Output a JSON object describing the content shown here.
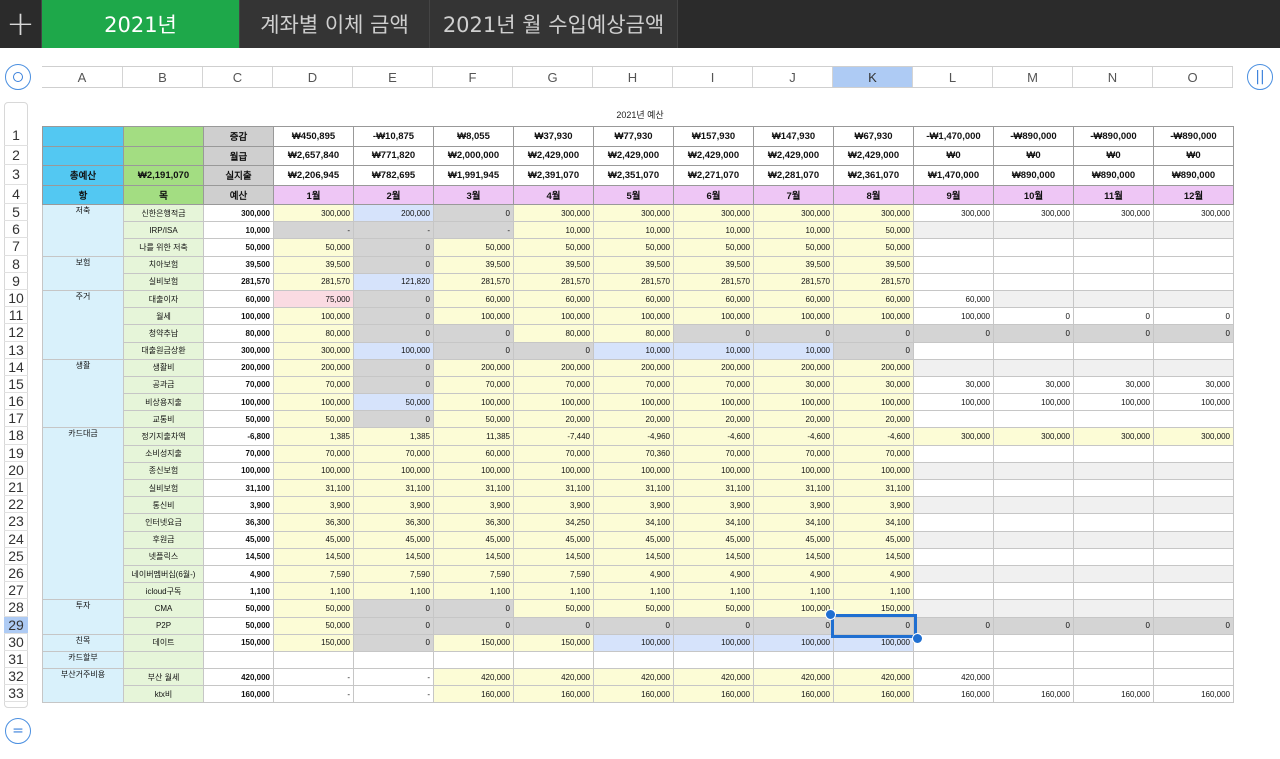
{
  "toolbar": {
    "add_label": "+"
  },
  "tabs": [
    "2021년",
    "계좌별 이체 금액",
    "2021년 월 수입예상금액"
  ],
  "left_circle": "",
  "right_circle": "||",
  "bottom_circle": "=",
  "columns": [
    "A",
    "B",
    "C",
    "D",
    "E",
    "F",
    "G",
    "H",
    "I",
    "J",
    "K",
    "L",
    "M",
    "N",
    "O"
  ],
  "selected_column": "K",
  "selected_row": 29,
  "sheet_title": "2021년 예산",
  "summary": {
    "left_a": [
      "",
      "",
      "총예산",
      "항"
    ],
    "left_b": [
      "",
      "",
      "₩2,191,070",
      "목"
    ],
    "left_c": [
      "증감",
      "월급",
      "실지출",
      "예산"
    ],
    "rows": [
      [
        "₩450,895",
        "-₩10,875",
        "₩8,055",
        "₩37,930",
        "₩77,930",
        "₩157,930",
        "₩147,930",
        "₩67,930",
        "-₩1,470,000",
        "-₩890,000",
        "-₩890,000",
        "-₩890,000"
      ],
      [
        "₩2,657,840",
        "₩771,820",
        "₩2,000,000",
        "₩2,429,000",
        "₩2,429,000",
        "₩2,429,000",
        "₩2,429,000",
        "₩2,429,000",
        "₩0",
        "₩0",
        "₩0",
        "₩0"
      ],
      [
        "₩2,206,945",
        "₩782,695",
        "₩1,991,945",
        "₩2,391,070",
        "₩2,351,070",
        "₩2,271,070",
        "₩2,281,070",
        "₩2,361,070",
        "₩1,470,000",
        "₩890,000",
        "₩890,000",
        "₩890,000"
      ]
    ],
    "months": [
      "1월",
      "2월",
      "3월",
      "4월",
      "5월",
      "6월",
      "7월",
      "8월",
      "9월",
      "10월",
      "11월",
      "12월"
    ]
  },
  "categories": [
    {
      "label": "저축",
      "rows": 3
    },
    {
      "label": "보험",
      "rows": 2
    },
    {
      "label": "주거",
      "rows": 4
    },
    {
      "label": "생활",
      "rows": 4
    },
    {
      "label": "카드대금",
      "rows": 10
    },
    {
      "label": "투자",
      "rows": 2
    },
    {
      "label": "친목",
      "rows": 1
    },
    {
      "label": "카드할부",
      "rows": 1
    },
    {
      "label": "부산거주비용",
      "rows": 2
    }
  ],
  "body": [
    {
      "n": 5,
      "item": "신한은행적금",
      "budget": "300,000",
      "v": [
        "300,000",
        "200,000",
        "0",
        "300,000",
        "300,000",
        "300,000",
        "300,000",
        "300,000",
        "300,000",
        "300,000",
        "300,000",
        "300,000"
      ],
      "c": "ybgyyyyywwww"
    },
    {
      "n": 6,
      "item": "IRP/ISA",
      "budget": "10,000",
      "v": [
        "-",
        "-",
        "-",
        "10,000",
        "10,000",
        "10,000",
        "10,000",
        "50,000",
        "",
        "",
        "",
        ""
      ],
      "c": "gggyyyyyllll"
    },
    {
      "n": 7,
      "item": "나를 위한 저축",
      "budget": "50,000",
      "v": [
        "50,000",
        "0",
        "50,000",
        "50,000",
        "50,000",
        "50,000",
        "50,000",
        "50,000",
        "",
        "",
        "",
        ""
      ],
      "c": "ygyyyyyywwww"
    },
    {
      "n": 8,
      "item": "치아보험",
      "budget": "39,500",
      "v": [
        "39,500",
        "0",
        "39,500",
        "39,500",
        "39,500",
        "39,500",
        "39,500",
        "39,500",
        "",
        "",
        "",
        ""
      ],
      "c": "ygyyyyyywwww"
    },
    {
      "n": 9,
      "item": "실비보험",
      "budget": "281,570",
      "v": [
        "281,570",
        "121,820",
        "281,570",
        "281,570",
        "281,570",
        "281,570",
        "281,570",
        "281,570",
        "",
        "",
        "",
        ""
      ],
      "c": "ybyyyyyywwww"
    },
    {
      "n": 10,
      "item": "대출이자",
      "budget": "60,000",
      "v": [
        "75,000",
        "0",
        "60,000",
        "60,000",
        "60,000",
        "60,000",
        "60,000",
        "60,000",
        "60,000",
        "",
        "",
        ""
      ],
      "c": "pgyyyyyywlll"
    },
    {
      "n": 11,
      "item": "월세",
      "budget": "100,000",
      "v": [
        "100,000",
        "0",
        "100,000",
        "100,000",
        "100,000",
        "100,000",
        "100,000",
        "100,000",
        "100,000",
        "0",
        "0",
        "0"
      ],
      "c": "ygyyyyyywwww"
    },
    {
      "n": 12,
      "item": "청약추납",
      "budget": "80,000",
      "v": [
        "80,000",
        "0",
        "0",
        "80,000",
        "80,000",
        "0",
        "0",
        "0",
        "0",
        "0",
        "0",
        "0"
      ],
      "c": "yggyyggggggg"
    },
    {
      "n": 13,
      "item": "대출원금상환",
      "budget": "300,000",
      "v": [
        "300,000",
        "100,000",
        "0",
        "0",
        "10,000",
        "10,000",
        "10,000",
        "0",
        "",
        "",
        "",
        ""
      ],
      "c": "ybggbbbgwwww"
    },
    {
      "n": 14,
      "item": "생활비",
      "budget": "200,000",
      "v": [
        "200,000",
        "0",
        "200,000",
        "200,000",
        "200,000",
        "200,000",
        "200,000",
        "200,000",
        "",
        "",
        "",
        ""
      ],
      "c": "ygyyyyyyllll"
    },
    {
      "n": 15,
      "item": "공과금",
      "budget": "70,000",
      "v": [
        "70,000",
        "0",
        "70,000",
        "70,000",
        "70,000",
        "70,000",
        "30,000",
        "30,000",
        "30,000",
        "30,000",
        "30,000",
        "30,000"
      ],
      "c": "ygyyyyyywwww"
    },
    {
      "n": 16,
      "item": "비상용지출",
      "budget": "100,000",
      "v": [
        "100,000",
        "50,000",
        "100,000",
        "100,000",
        "100,000",
        "100,000",
        "100,000",
        "100,000",
        "100,000",
        "100,000",
        "100,000",
        "100,000"
      ],
      "c": "ybyyyyyywwww"
    },
    {
      "n": 17,
      "item": "교통비",
      "budget": "50,000",
      "v": [
        "50,000",
        "0",
        "50,000",
        "20,000",
        "20,000",
        "20,000",
        "20,000",
        "20,000",
        "",
        "",
        "",
        ""
      ],
      "c": "ygyyyyyywwww"
    },
    {
      "n": 18,
      "item": "정기지출차액",
      "budget": "-6,800",
      "v": [
        "1,385",
        "1,385",
        "11,385",
        "-7,440",
        "-4,960",
        "-4,600",
        "-4,600",
        "-4,600",
        "300,000",
        "300,000",
        "300,000",
        "300,000"
      ],
      "c": "yyyyyyyyyyyy"
    },
    {
      "n": 19,
      "item": "소비성지출",
      "budget": "70,000",
      "v": [
        "70,000",
        "70,000",
        "60,000",
        "70,000",
        "70,360",
        "70,000",
        "70,000",
        "70,000",
        "",
        "",
        "",
        ""
      ],
      "c": "yyyyyyyywwww"
    },
    {
      "n": 20,
      "item": "종신보험",
      "budget": "100,000",
      "v": [
        "100,000",
        "100,000",
        "100,000",
        "100,000",
        "100,000",
        "100,000",
        "100,000",
        "100,000",
        "",
        "",
        "",
        ""
      ],
      "c": "yyyyyyyyllll"
    },
    {
      "n": 21,
      "item": "실비보험",
      "budget": "31,100",
      "v": [
        "31,100",
        "31,100",
        "31,100",
        "31,100",
        "31,100",
        "31,100",
        "31,100",
        "31,100",
        "",
        "",
        "",
        ""
      ],
      "c": "yyyyyyyywwww"
    },
    {
      "n": 22,
      "item": "통신비",
      "budget": "3,900",
      "v": [
        "3,900",
        "3,900",
        "3,900",
        "3,900",
        "3,900",
        "3,900",
        "3,900",
        "3,900",
        "",
        "",
        "",
        ""
      ],
      "c": "yyyyyyyyllll"
    },
    {
      "n": 23,
      "item": "인터넷요금",
      "budget": "36,300",
      "v": [
        "36,300",
        "36,300",
        "36,300",
        "34,250",
        "34,100",
        "34,100",
        "34,100",
        "34,100",
        "",
        "",
        "",
        ""
      ],
      "c": "yyyyyyyywwww"
    },
    {
      "n": 24,
      "item": "후원금",
      "budget": "45,000",
      "v": [
        "45,000",
        "45,000",
        "45,000",
        "45,000",
        "45,000",
        "45,000",
        "45,000",
        "45,000",
        "",
        "",
        "",
        ""
      ],
      "c": "yyyyyyyyllll"
    },
    {
      "n": 25,
      "item": "넷플릭스",
      "budget": "14,500",
      "v": [
        "14,500",
        "14,500",
        "14,500",
        "14,500",
        "14,500",
        "14,500",
        "14,500",
        "14,500",
        "",
        "",
        "",
        ""
      ],
      "c": "yyyyyyyywwww"
    },
    {
      "n": 26,
      "item": "네이버멤버십(6월-)",
      "budget": "4,900",
      "v": [
        "7,590",
        "7,590",
        "7,590",
        "7,590",
        "4,900",
        "4,900",
        "4,900",
        "4,900",
        "",
        "",
        "",
        ""
      ],
      "c": "yyyyyyyyllll"
    },
    {
      "n": 27,
      "item": "icloud구독",
      "budget": "1,100",
      "v": [
        "1,100",
        "1,100",
        "1,100",
        "1,100",
        "1,100",
        "1,100",
        "1,100",
        "1,100",
        "",
        "",
        "",
        ""
      ],
      "c": "yyyyyyyywwww"
    },
    {
      "n": 28,
      "item": "CMA",
      "budget": "50,000",
      "v": [
        "50,000",
        "0",
        "0",
        "50,000",
        "50,000",
        "50,000",
        "100,000",
        "150,000",
        "",
        "",
        "",
        ""
      ],
      "c": "yggyyyyyllll"
    },
    {
      "n": 29,
      "item": "P2P",
      "budget": "50,000",
      "v": [
        "50,000",
        "0",
        "0",
        "0",
        "0",
        "0",
        "0",
        "0",
        "0",
        "0",
        "0",
        "0"
      ],
      "c": "yggggggggggg"
    },
    {
      "n": 30,
      "item": "데이트",
      "budget": "150,000",
      "v": [
        "150,000",
        "0",
        "150,000",
        "150,000",
        "100,000",
        "100,000",
        "100,000",
        "100,000",
        "",
        "",
        "",
        ""
      ],
      "c": "ygyybbbbwwww"
    },
    {
      "n": 31,
      "item": "",
      "budget": "",
      "v": [
        "",
        "",
        "",
        "",
        "",
        "",
        "",
        "",
        "",
        "",
        "",
        ""
      ],
      "c": "wwwwwwwwwwww"
    },
    {
      "n": 32,
      "item": "부산 월세",
      "budget": "420,000",
      "v": [
        "-",
        "-",
        "420,000",
        "420,000",
        "420,000",
        "420,000",
        "420,000",
        "420,000",
        "420,000",
        "",
        "",
        ""
      ],
      "c": "wwyyyyyywwww"
    },
    {
      "n": 33,
      "item": "ktx비",
      "budget": "160,000",
      "v": [
        "-",
        "-",
        "160,000",
        "160,000",
        "160,000",
        "160,000",
        "160,000",
        "160,000",
        "160,000",
        "160,000",
        "160,000",
        "160,000"
      ],
      "c": "wwyyyyyywwww"
    }
  ]
}
